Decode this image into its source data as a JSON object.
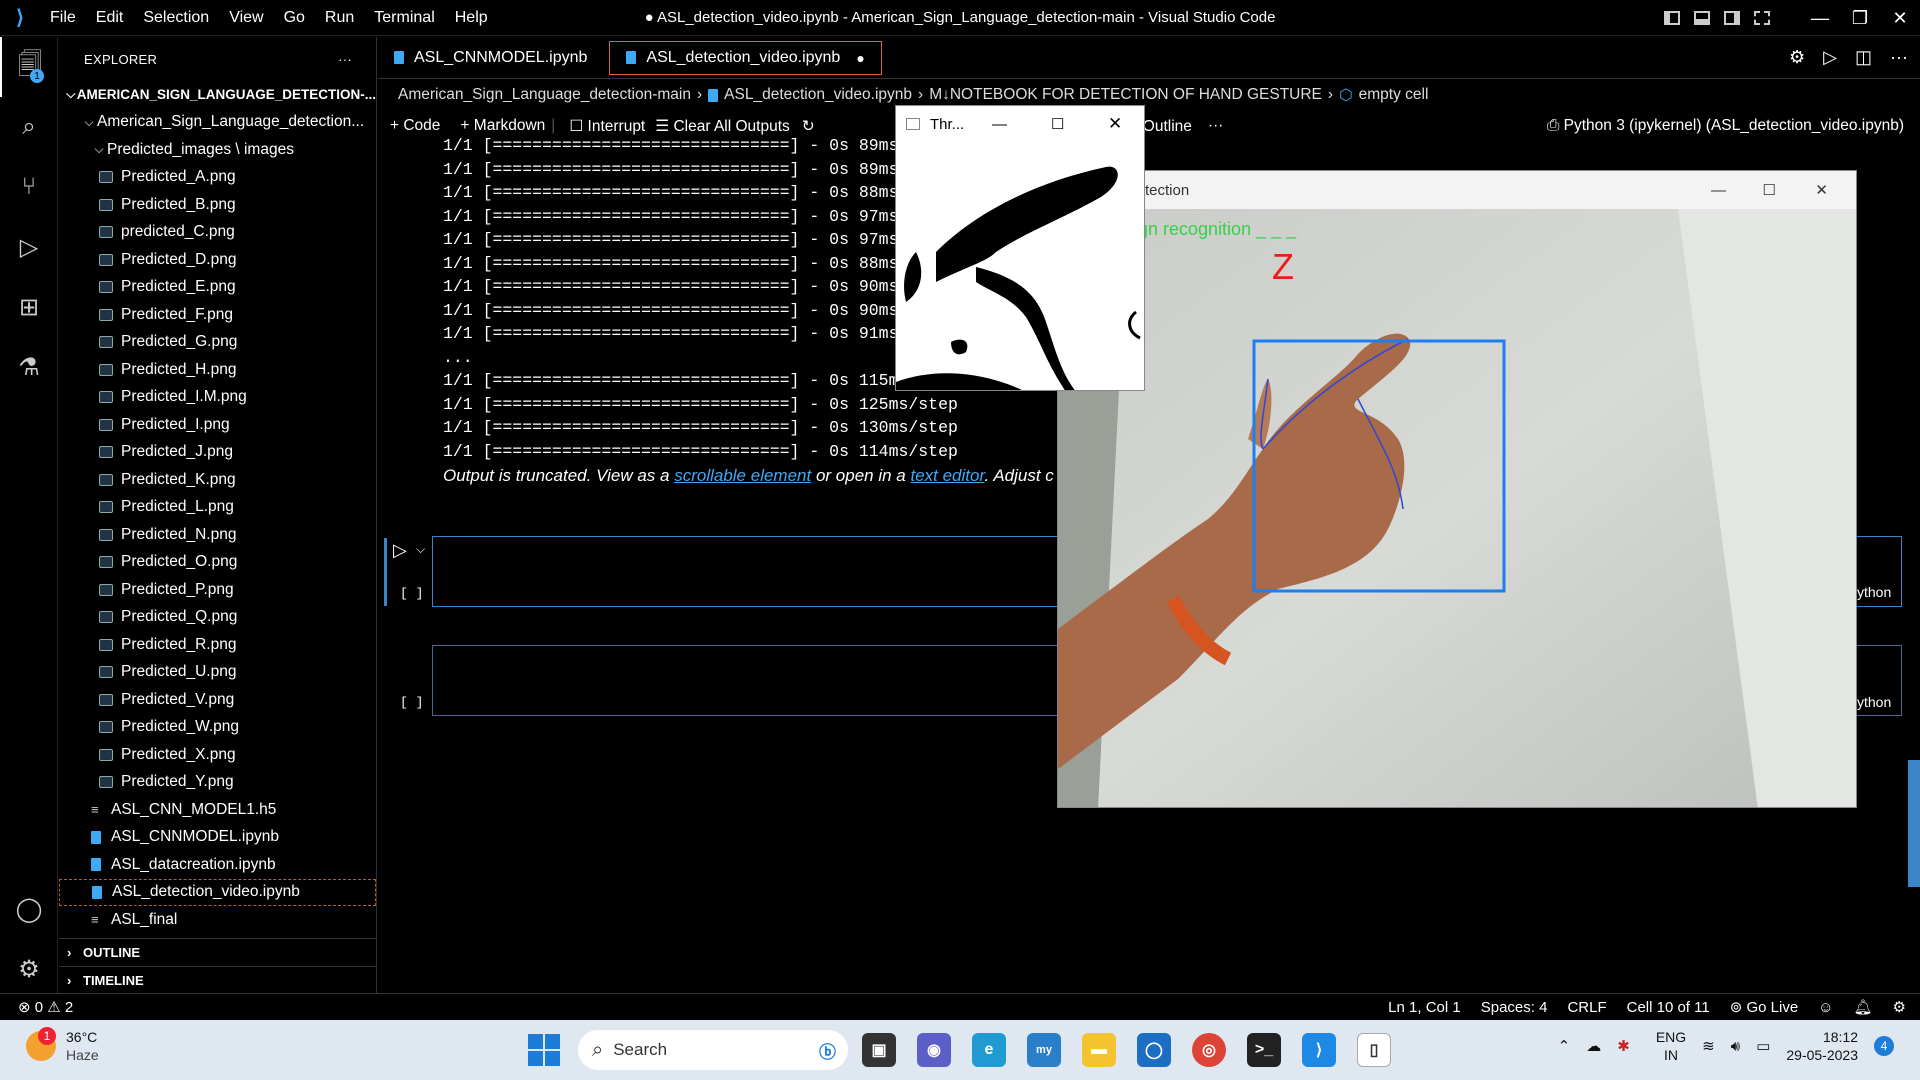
{
  "titlebar": {
    "menu": [
      "File",
      "Edit",
      "Selection",
      "View",
      "Go",
      "Run",
      "Terminal",
      "Help"
    ],
    "title": "● ASL_detection_video.ipynb - American_Sign_Language_detection-main - Visual Studio Code"
  },
  "activity": {
    "explorer_badge": "1"
  },
  "explorer": {
    "header": "EXPLORER",
    "more": "···",
    "root": "AMERICAN_SIGN_LANGUAGE_DETECTION-...",
    "folder": "American_Sign_Language_detection...",
    "subfolder": "Predicted_images \\ images",
    "images": [
      "Predicted_A.png",
      "Predicted_B.png",
      "predicted_C.png",
      "Predicted_D.png",
      "Predicted_E.png",
      "Predicted_F.png",
      "Predicted_G.png",
      "Predicted_H.png",
      "Predicted_I.M.png",
      "Predicted_I.png",
      "Predicted_J.png",
      "Predicted_K.png",
      "Predicted_L.png",
      "Predicted_N.png",
      "Predicted_O.png",
      "Predicted_P.png",
      "Predicted_Q.png",
      "Predicted_R.png",
      "Predicted_U.png",
      "Predicted_V.png",
      "Predicted_W.png",
      "Predicted_X.png",
      "Predicted_Y.png"
    ],
    "files": [
      "ASL_CNN_MODEL1.h5",
      "ASL_CNNMODEL.ipynb",
      "ASL_datacreation.ipynb",
      "ASL_detection_video.ipynb",
      "ASL_final"
    ],
    "outline": "OUTLINE",
    "timeline": "TIMELINE"
  },
  "tabs": [
    {
      "label": "ASL_CNNMODEL.ipynb"
    },
    {
      "label": "ASL_detection_video.ipynb"
    }
  ],
  "breadcrumb": [
    "American_Sign_Language_detection-main",
    "ASL_detection_video.ipynb",
    "M↓NOTEBOOK FOR DETECTION OF HAND GESTURE",
    "empty cell"
  ],
  "nbtoolbar": {
    "code": "Code",
    "markdown": "Markdown",
    "interrupt": "Interrupt",
    "clear": "Clear All Outputs",
    "variables": "les",
    "outline": "Outline",
    "more": "···",
    "kernel": "Python 3 (ipykernel) (ASL_detection_video.ipynb)"
  },
  "output": {
    "lines": [
      "1/1 [==============================] - 0s 89ms/",
      "1/1 [==============================] - 0s 89ms/",
      "1/1 [==============================] - 0s 88ms/",
      "1/1 [==============================] - 0s 97ms/",
      "1/1 [==============================] - 0s 97ms/",
      "1/1 [==============================] - 0s 88ms/",
      "1/1 [==============================] - 0s 90ms/",
      "1/1 [==============================] - 0s 90ms/",
      "1/1 [==============================] - 0s 91ms/",
      "...",
      "1/1 [==============================] - 0s 115ms",
      "1/1 [==============================] - 0s 125ms/step",
      "1/1 [==============================] - 0s 130ms/step",
      "1/1 [==============================] - 0s 114ms/step"
    ],
    "note_pre": "Output is truncated. View as a ",
    "note_link1": "scrollable element",
    "note_mid": " or open in a ",
    "note_link2": "text editor",
    "note_post": ". Adjust c"
  },
  "cells": {
    "exec1": "[ ]",
    "exec2": "[ ]",
    "lang1": "ython",
    "lang2": "ython"
  },
  "threshold_window": {
    "title": "Thr..."
  },
  "camera_window": {
    "title": "tection",
    "overlay_text": "gn recognition _ _ _",
    "prediction": "Z"
  },
  "status": {
    "errors": "0",
    "warnings": "2",
    "position": "Ln 1, Col 1",
    "spaces": "Spaces: 4",
    "eol": "CRLF",
    "cell": "Cell 10 of 11",
    "golive": "Go Live"
  },
  "taskbar": {
    "weather_temp": "36°C",
    "weather_desc": "Haze",
    "weather_badge": "1",
    "search": "Search",
    "lang1": "ENG",
    "lang2": "IN",
    "time": "18:12",
    "date": "29-05-2023",
    "notif": "4"
  }
}
